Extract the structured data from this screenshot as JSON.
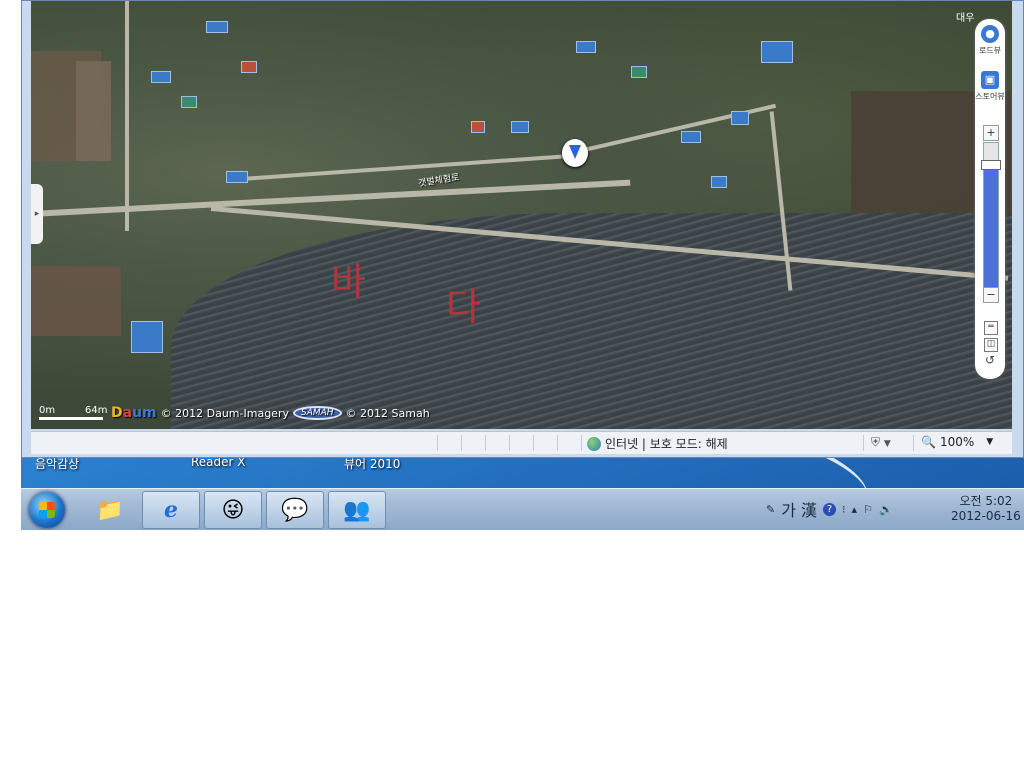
{
  "desktop": {
    "labels": [
      "음악감상",
      "Reader X",
      "뷰어 2010"
    ]
  },
  "map": {
    "road_label": "갯벌체험로",
    "handwriting": [
      "바",
      "다"
    ],
    "side_tab_arrow": "▸",
    "controls": {
      "roadview_label": "로드뷰",
      "storeview_label": "스토어뷰",
      "roadview_icon": "roadview-icon",
      "storeview_icon": "storeview-icon",
      "zoom_in": "+",
      "zoom_out": "−",
      "zoom_level_fraction": 0.12,
      "tool_ruler": "ruler-icon",
      "tool_area": "area-icon",
      "tool_reset": "reset-icon"
    },
    "corner_label": "대우",
    "scale": {
      "min": "0m",
      "max": "64m"
    },
    "credits": {
      "daum_letters": [
        "D",
        "a",
        "um"
      ],
      "daum_copyright": "© 2012 Daum-Imagery",
      "samah_logo": "SAMAH",
      "samah_copyright": "© 2012 Samah"
    }
  },
  "statusbar": {
    "zone_text": "인터넷 | 보호 모드: 해제",
    "zoom": "100%",
    "zoom_arrow": "▼",
    "security_arrow": "▼"
  },
  "taskbar": {
    "items": [
      {
        "icon": "folder-icon",
        "glyph": "📁"
      },
      {
        "icon": "internet-explorer-icon",
        "glyph": "e"
      },
      {
        "icon": "messenger-icon",
        "glyph": "😜"
      },
      {
        "icon": "chat-icon",
        "glyph": "💬"
      },
      {
        "icon": "users-icon",
        "glyph": "👥"
      }
    ],
    "tray": {
      "ime": "가 漢",
      "help": "?",
      "up_arrow": "▴"
    },
    "clock": {
      "time": "오전 5:02",
      "date": "2012-06-16"
    }
  },
  "colors": {
    "sea": "#3b4247",
    "zoom_track": "#4d6fd9",
    "handwriting": "#c4303a"
  }
}
